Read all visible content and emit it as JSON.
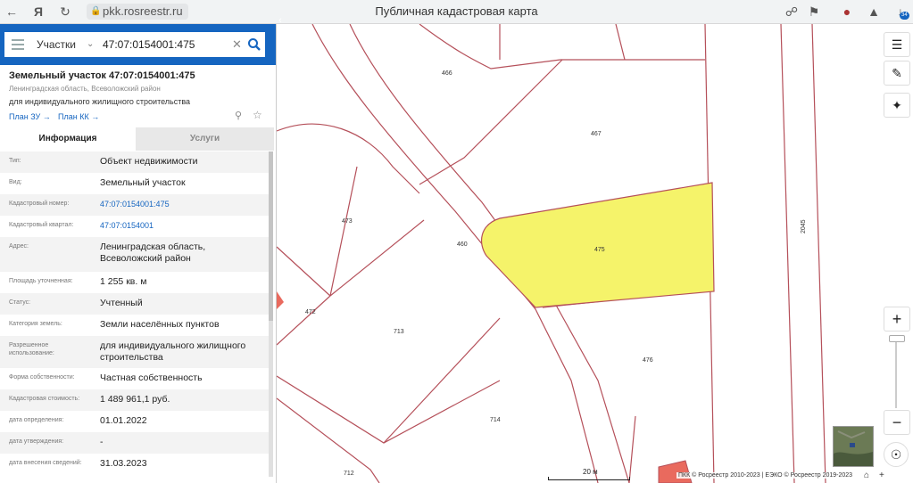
{
  "browser": {
    "url": "pkk.rosreestr.ru",
    "title": "Публичная кадастровая карта",
    "download_badge": "34"
  },
  "search": {
    "type_label": "Участки",
    "query": "47:07:0154001:475"
  },
  "object": {
    "title": "Земельный участок 47:07:0154001:475",
    "region": "Ленинградская область, Всеволожский район",
    "use": "для индивидуального жилищного строительства",
    "plan_zu": "План ЗУ",
    "plan_kk": "План КК"
  },
  "tabs": {
    "info": "Информация",
    "services": "Услуги"
  },
  "rows": [
    {
      "k": "Тип:",
      "v": "Объект недвижимости"
    },
    {
      "k": "Вид:",
      "v": "Земельный участок"
    },
    {
      "k": "Кадастровый номер:",
      "v": "47:07:0154001:475"
    },
    {
      "k": "Кадастровый квартал:",
      "v": "47:07:0154001"
    },
    {
      "k": "Адрес:",
      "v": "Ленинградская область, Всеволожский район"
    },
    {
      "k": "Площадь уточненная:",
      "v": "1 255 кв. м"
    },
    {
      "k": "Статус:",
      "v": "Учтенный"
    },
    {
      "k": "Категория земель:",
      "v": "Земли населённых пунктов"
    },
    {
      "k": "Разрешенное использование:",
      "v": "для индивидуального жилищного строительства"
    },
    {
      "k": "Форма собственности:",
      "v": "Частная собственность"
    },
    {
      "k": "Кадастровая стоимость:",
      "v": "1 489 961,1 руб."
    },
    {
      "k": "дата определения:",
      "v": "01.01.2022"
    },
    {
      "k": "дата утверждения:",
      "v": "-"
    },
    {
      "k": "дата внесения сведений:",
      "v": "31.03.2023"
    }
  ],
  "map": {
    "parcel_labels": [
      "466",
      "467",
      "473",
      "460",
      "475",
      "2045",
      "472",
      "713",
      "476",
      "714",
      "712"
    ],
    "highlight_color": "#f5f36a",
    "boundary_color": "#b5505a",
    "scale": "20 м",
    "copyright": "ПКК © Росреестр 2010-2023 | ЕЭКО © Росреестр 2019-2023"
  }
}
